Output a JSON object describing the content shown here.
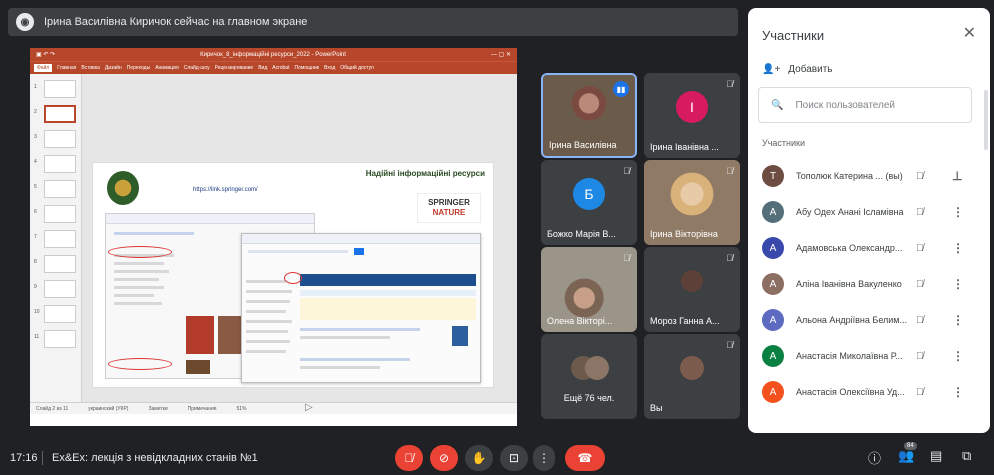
{
  "banner": {
    "text": "Ірина Василівна Киричок сейчас на главном экране"
  },
  "powerpoint": {
    "title": "Киричок_8_інформаційні ресурси_2022 - PowerPoint",
    "tabs": [
      "Файл",
      "Главная",
      "Вставка",
      "Дизайн",
      "Переходы",
      "Анимация",
      "Слайд-шоу",
      "Рецензирование",
      "Вид",
      "Acrobat",
      "Помощник",
      "Вход",
      "Общий доступ"
    ],
    "active_tab": "Файл",
    "thumb_numbers": [
      "1",
      "2",
      "3",
      "4",
      "5",
      "6",
      "7",
      "8",
      "9",
      "10",
      "11"
    ],
    "status": [
      "Слайд 2 из 11",
      "украинский (УКР)",
      "Заметки",
      "Примечания",
      "51%"
    ],
    "slide": {
      "heading": "Надійні інформаційні ресурси",
      "url": "https://link.springer.com/",
      "logo_line1": "SPRINGER",
      "logo_line2": "NATURE"
    }
  },
  "tiles": [
    {
      "name": "Ірина Василівна",
      "speaking": true
    },
    {
      "name": "Ірина Іванівна ...",
      "initial": "І",
      "color": "#d81b60",
      "muted": true
    },
    {
      "name": "Божко Марія В...",
      "initial": "Б",
      "color": "#1e88e5",
      "muted": true
    },
    {
      "name": "Ірина Вікторівна",
      "muted": true
    },
    {
      "name": "Олена Вікторі...",
      "muted": true
    },
    {
      "name": "Мороз Ганна А...",
      "muted": true
    },
    {
      "name": "Ещё 76 чел."
    },
    {
      "name": "Вы",
      "muted": true
    }
  ],
  "panel": {
    "title": "Участники",
    "add_label": "Добавить",
    "search_placeholder": "Поиск пользователей",
    "section": "Участники",
    "participants": [
      {
        "name": "Тополюк Катерина ... (вы)",
        "initial": "Т",
        "color": "#6d4c41"
      },
      {
        "name": "Абу Одех Анані Ісламівна",
        "initial": "А",
        "color": "#546e7a"
      },
      {
        "name": "Адамовська Олександр...",
        "initial": "А",
        "color": "#3949ab"
      },
      {
        "name": "Аліна Іванівна Вакуленко",
        "initial": "A",
        "color": "#8d6e63"
      },
      {
        "name": "Альона Андріївна Белим...",
        "initial": "A",
        "color": "#5c6bc0"
      },
      {
        "name": "Анастасія Миколаївна Р...",
        "initial": "A",
        "color": "#0b8043"
      },
      {
        "name": "Анастасія Олексіївна Уд...",
        "initial": "A",
        "color": "#f4511e"
      }
    ]
  },
  "bottom": {
    "time": "17:16",
    "meeting": "Ex&Ex: лекція з невідкладних станів №1",
    "participants_count": "84"
  }
}
